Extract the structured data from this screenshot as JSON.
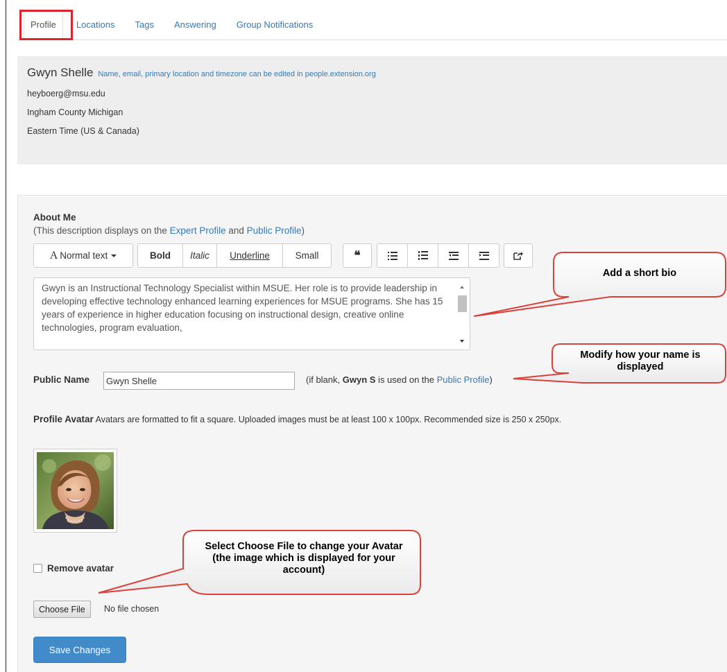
{
  "tabs": [
    {
      "label": "Profile",
      "active": true
    },
    {
      "label": "Locations",
      "active": false
    },
    {
      "label": "Tags",
      "active": false
    },
    {
      "label": "Answering",
      "active": false
    },
    {
      "label": "Group Notifications",
      "active": false
    }
  ],
  "info": {
    "name": "Gwyn Shelle",
    "hint": "Name, email, primary location and timezone can be edited in people.extension.org",
    "email": "heyboerg@msu.edu",
    "location": "Ingham County Michigan",
    "timezone": "Eastern Time (US & Canada)"
  },
  "about": {
    "title": "About Me",
    "note_prefix": "(This description displays on the ",
    "expert_link": "Expert Profile",
    "note_and": " and ",
    "public_link": "Public Profile",
    "note_suffix": ")",
    "bio_text": "Gwyn is an Instructional Technology Specialist within MSUE. Her role is to provide leadership in developing effective technology enhanced learning experiences for MSUE programs. She has 15 years of experience in higher education focusing on instructional design, creative online technologies, program evaluation,"
  },
  "toolbar": {
    "text_style": "Normal text",
    "bold": "Bold",
    "italic": "Italic",
    "underline": "Underline",
    "small": "Small",
    "quote_glyph": "❝",
    "icons": [
      "format-select-icon",
      "blockquote-icon",
      "unordered-list-icon",
      "ordered-list-icon",
      "outdent-icon",
      "indent-icon",
      "link-share-icon"
    ]
  },
  "public_name": {
    "label": "Public Name",
    "value": "Gwyn Shelle",
    "note_prefix": "(if blank, ",
    "note_bold": "Gwyn S",
    "note_middle": " is used on the ",
    "note_link": "Public Profile",
    "note_suffix": ")"
  },
  "avatar": {
    "label": "Profile Avatar",
    "description": "Avatars are formatted to fit a square. Uploaded images must be at least 100 x 100px. Recommended size is 250 x 250px.",
    "remove_label": "Remove avatar",
    "remove_checked": false,
    "choose_file": "Choose File",
    "no_file": "No file chosen"
  },
  "save_label": "Save Changes",
  "callouts": {
    "bio": "Add a short bio",
    "name": "Modify how your name is displayed",
    "avatar": "Select Choose File to change your Avatar (the image which is displayed for your account)"
  },
  "colors": {
    "link": "#337ab7",
    "primary_button": "#428bca",
    "highlight_red": "#e0232b",
    "callout_stroke": "#d9413a"
  }
}
